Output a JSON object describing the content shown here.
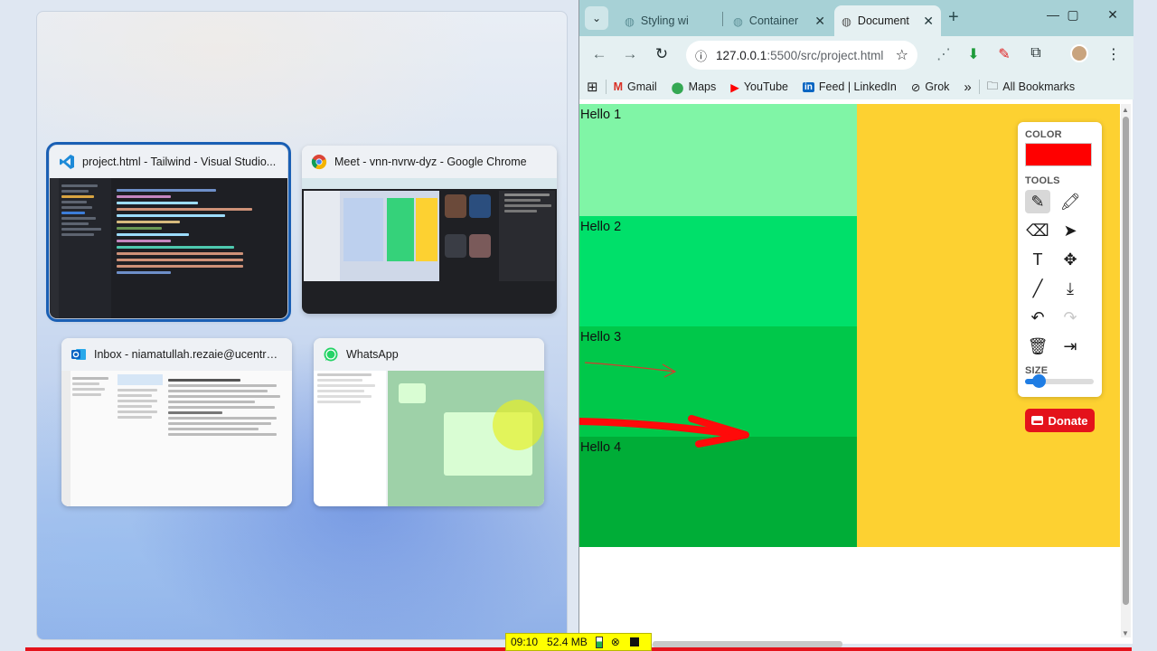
{
  "snap": {
    "windows": [
      {
        "title": "project.html - Tailwind - Visual Studio...",
        "app": "Visual Studio Code"
      },
      {
        "title": "Meet - vnn-nvrw-dyz - Google Chrome",
        "app": "Google Chrome"
      },
      {
        "title": "Inbox - niamatullah.rezaie@ucentralasi...",
        "app": "Outlook"
      },
      {
        "title": "WhatsApp",
        "app": "WhatsApp"
      }
    ]
  },
  "browser": {
    "tabs": [
      {
        "label": "Styling wi",
        "active": false
      },
      {
        "label": "Container",
        "active": false
      },
      {
        "label": "Document",
        "active": true
      }
    ],
    "new_tab": "+",
    "window_controls": {
      "minimize": "—",
      "maximize": "▢",
      "close": "✕"
    },
    "address": {
      "host": "127.0.0.1",
      "path": ":5500/src/project.html"
    },
    "bookmarks": [
      "Gmail",
      "Maps",
      "YouTube",
      "Feed | LinkedIn",
      "Grok"
    ],
    "bookmarks_overflow": "»",
    "all_bookmarks": "All Bookmarks"
  },
  "page": {
    "sections": [
      {
        "label": "Hello 1",
        "color": "#80f5a6"
      },
      {
        "label": "Hello 2",
        "color": "#00e06a"
      },
      {
        "label": "Hello 3",
        "color": "#00c84a"
      },
      {
        "label": "Hello 4",
        "color": "#00ad37"
      }
    ],
    "side_color": "#fdd131"
  },
  "paint_panel": {
    "color_heading": "COLOR",
    "color_value": "#ff0000",
    "tools_heading": "TOOLS",
    "tools": [
      {
        "icon": "pencil-icon",
        "glyph": "✎",
        "selected": true
      },
      {
        "icon": "marker-icon",
        "glyph": "🖍",
        "selected": false
      },
      {
        "icon": "eraser-icon",
        "glyph": "⌫",
        "selected": false
      },
      {
        "icon": "pointer-icon",
        "glyph": "➤",
        "selected": false
      },
      {
        "icon": "text-icon",
        "glyph": "T",
        "selected": false
      },
      {
        "icon": "move-icon",
        "glyph": "✥",
        "selected": false
      },
      {
        "icon": "line-icon",
        "glyph": "╱",
        "selected": false
      },
      {
        "icon": "download-icon",
        "glyph": "⤓",
        "selected": false
      },
      {
        "icon": "undo-icon",
        "glyph": "↶",
        "selected": false
      },
      {
        "icon": "redo-icon",
        "glyph": "↷",
        "selected": false,
        "disabled": true
      },
      {
        "icon": "trash-icon",
        "glyph": "🗑",
        "selected": false
      },
      {
        "icon": "exit-icon",
        "glyph": "⇥",
        "selected": false
      }
    ],
    "size_heading": "SIZE",
    "size_value": 0.2,
    "donate_label": "Donate"
  },
  "statusbar": {
    "time": "09:10",
    "memory": "52.4 MB"
  }
}
